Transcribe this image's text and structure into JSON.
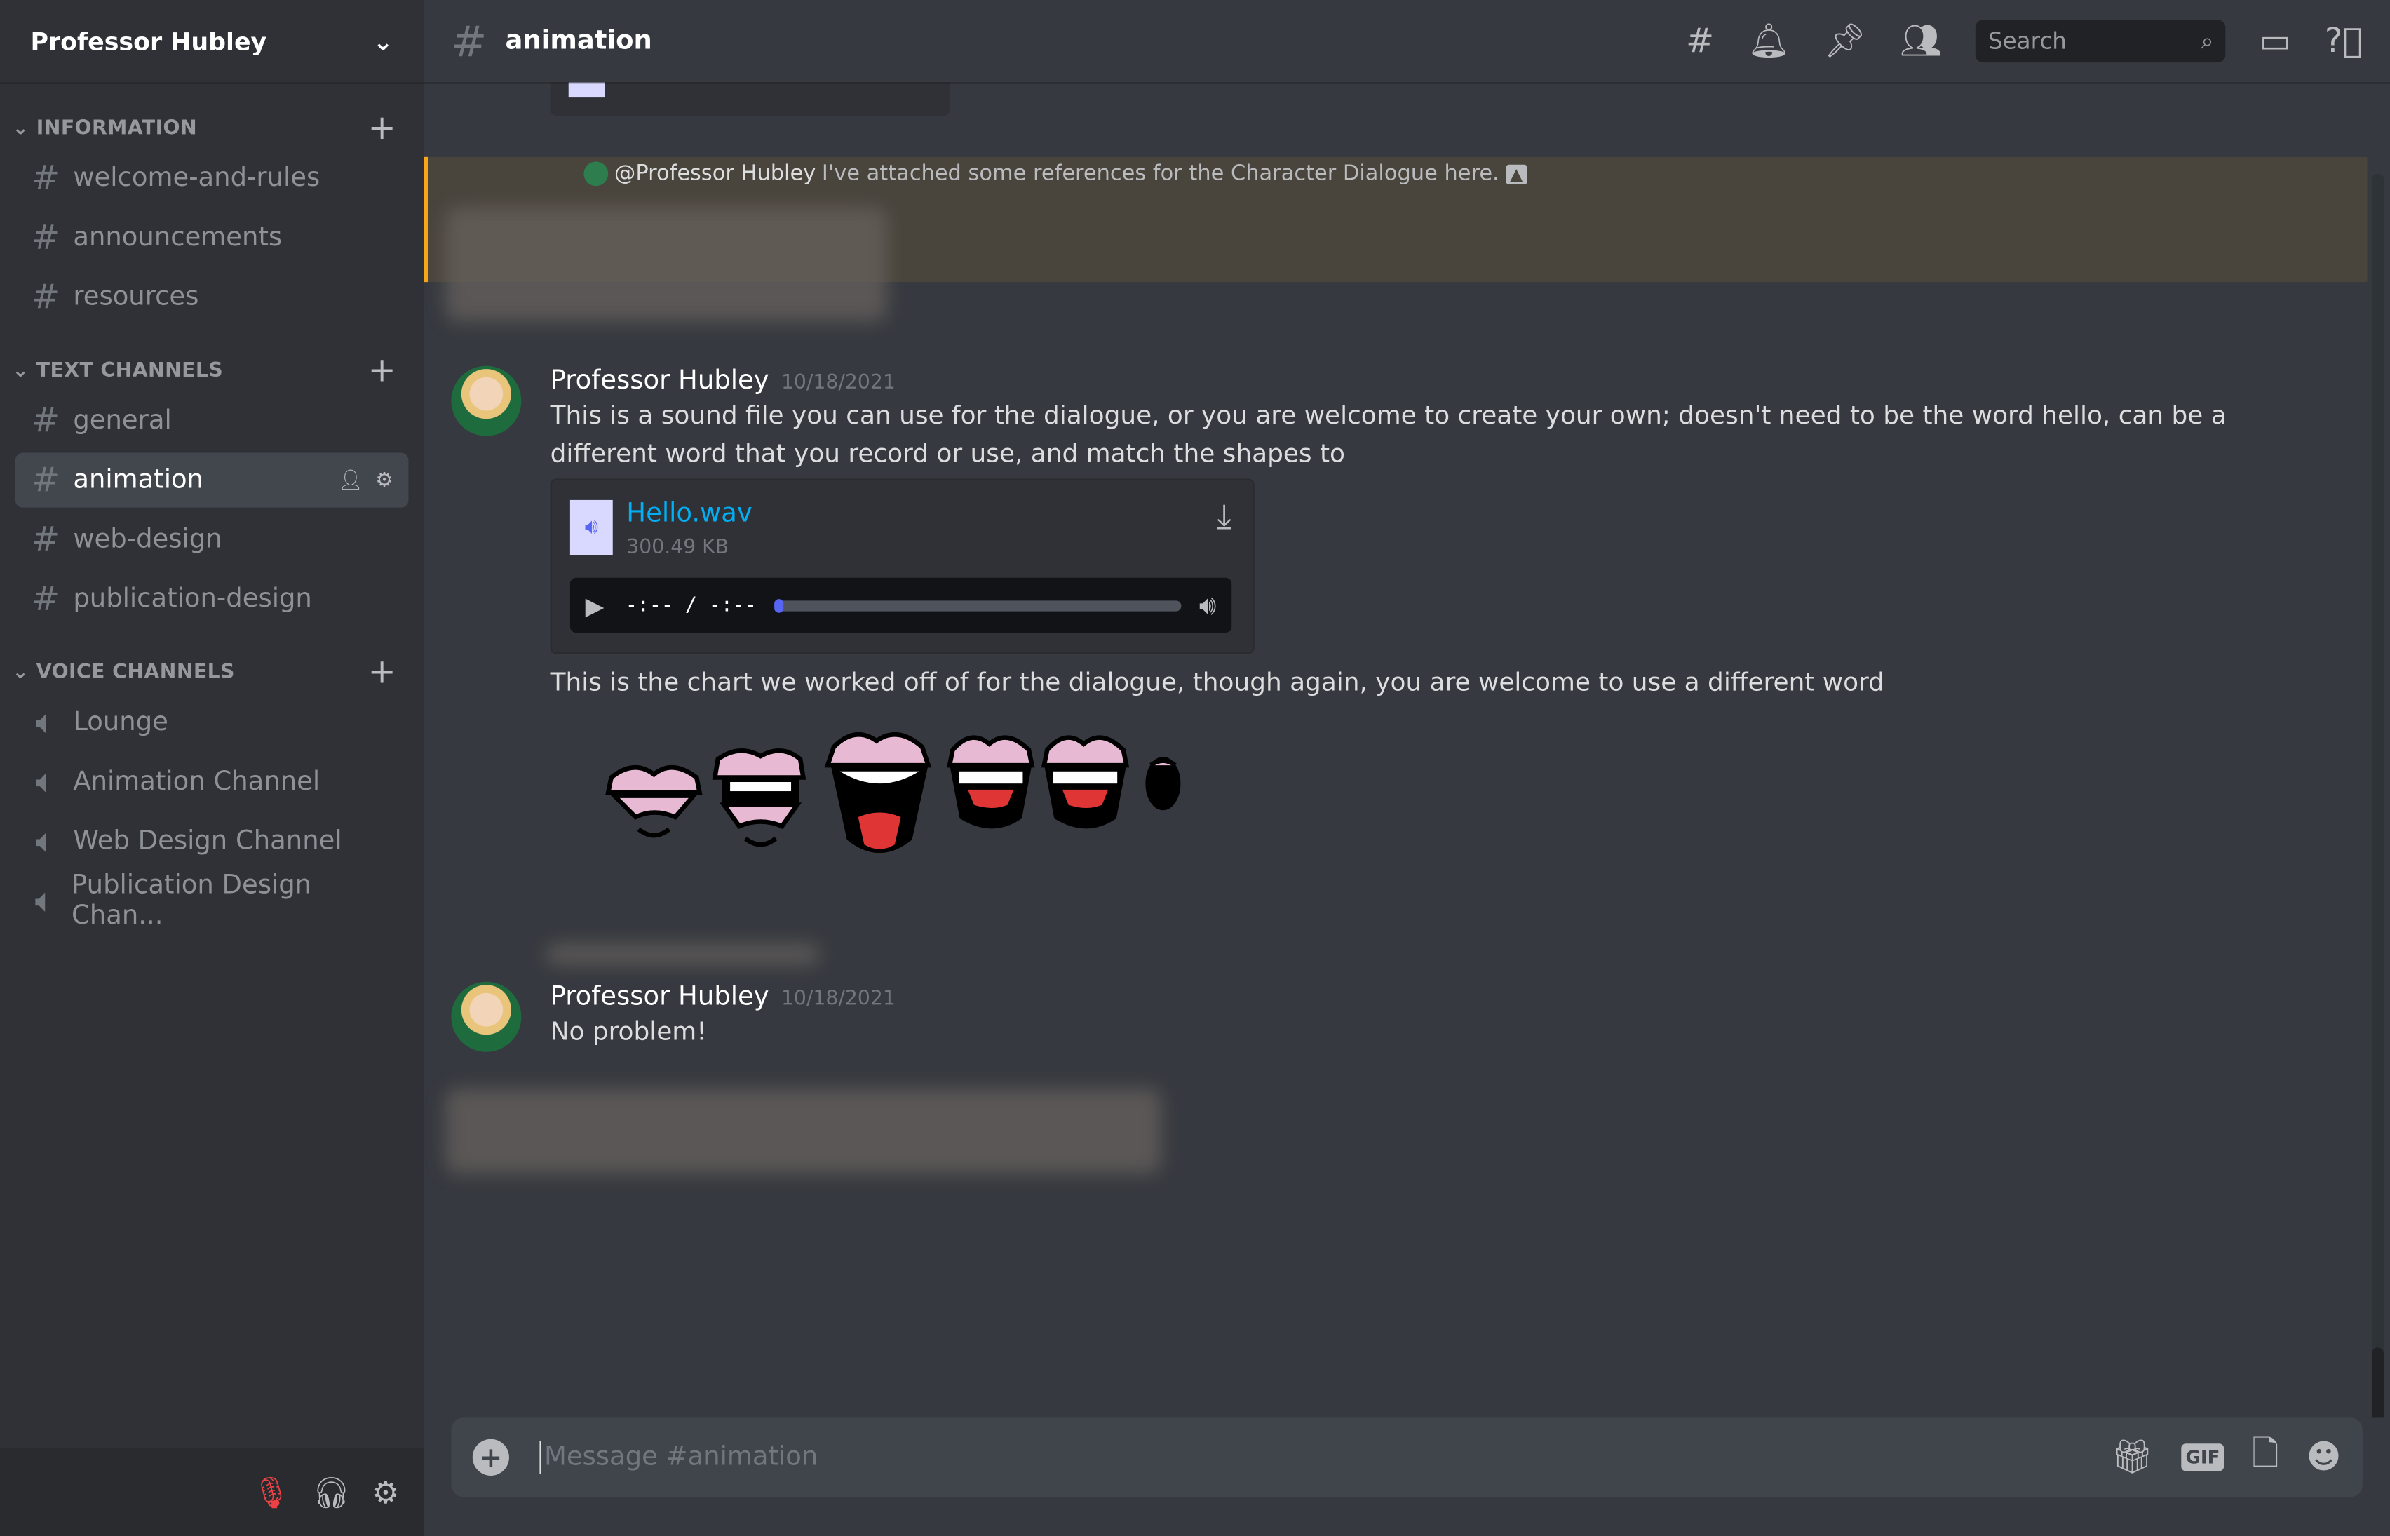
{
  "server": {
    "name": "Professor Hubley"
  },
  "categories": [
    {
      "name": "INFORMATION",
      "channels": [
        "welcome-and-rules",
        "announcements",
        "resources"
      ]
    },
    {
      "name": "TEXT CHANNELS",
      "channels": [
        "general",
        "animation",
        "web-design",
        "publication-design"
      ]
    },
    {
      "name": "VOICE CHANNELS",
      "channels": [
        "Lounge",
        "Animation Channel",
        "Web Design Channel",
        "Publication Design Chan..."
      ]
    }
  ],
  "active_channel": "animation",
  "header": {
    "hash": "#",
    "channel": "animation",
    "search_placeholder": "Search"
  },
  "reply": {
    "mention": "@Professor Hubley",
    "text": "I've attached some references for the Character Dialogue here."
  },
  "messages": [
    {
      "author": "Professor Hubley",
      "timestamp": "10/18/2021",
      "text1": "This is a sound file you can use for the dialogue, or you are welcome to create your own; doesn't need to be the word hello, can be a different word that you record or use, and match the shapes to",
      "attachment": {
        "name": "Hello.wav",
        "size": "300.49 KB",
        "time": "-:-- / -:--",
        "progress": 0
      },
      "text2": "This is the chart we worked off of for the dialogue, though again, you are welcome to use a different word"
    },
    {
      "author": "Professor Hubley",
      "timestamp": "10/18/2021",
      "text": "No problem!"
    }
  ],
  "composer": {
    "placeholder": "Message #animation",
    "gif": "GIF"
  },
  "colors": {
    "accent": "#5865f2",
    "link": "#00aff4",
    "mention_bar": "#faa61a"
  }
}
